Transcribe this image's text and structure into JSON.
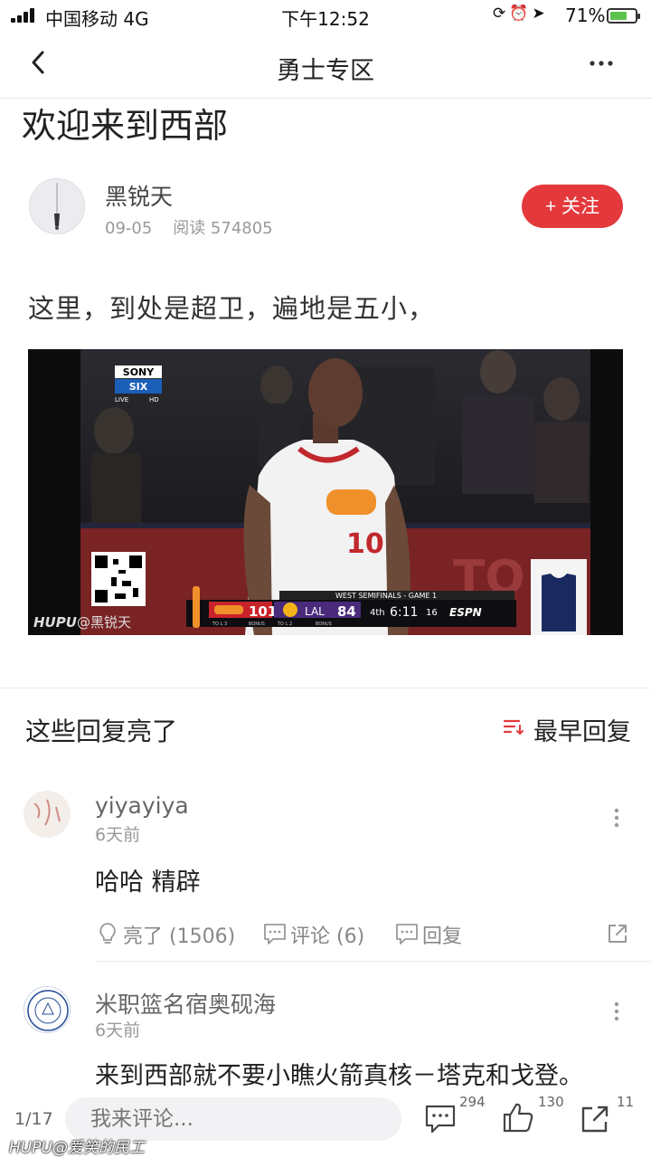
{
  "status_bar": {
    "carrier": "中国移动  4G",
    "time": "下午12:52",
    "battery_pct": "71%",
    "battery_level": 0.71,
    "icons": [
      "rotation-lock-icon",
      "alarm-icon",
      "location-icon"
    ]
  },
  "nav": {
    "title": "勇士专区"
  },
  "article": {
    "title": "欢迎来到西部",
    "author": "黑锐天",
    "date": "09-05",
    "reads": "阅读 574805",
    "follow_label": "+ 关注",
    "body": "这里，到处是超卫，遍地是五小，",
    "image": {
      "network": "SONY",
      "channel": "SIX",
      "channel_sub": "LIVE",
      "channel_hd": "HD",
      "hupu_watermark": "HUPU",
      "hupu_user": "@黑锐天",
      "jersey_number": "10",
      "scorebug": {
        "header": "WEST SEMIFINALS - GAME 1",
        "home_score": "101",
        "away_team": "LAL",
        "away_score": "84",
        "quarter": "4th",
        "clock": "6:11",
        "shot_clock": "16",
        "network": "ESPN",
        "bonus1": "BONUS",
        "bonus2": "BONUS",
        "tol1": "TO L 3",
        "tol2": "TO L 2"
      }
    }
  },
  "replies": {
    "header": "这些回复亮了",
    "sort_label": "最早回复",
    "comments": [
      {
        "name": "yiyayiya",
        "time": "6天前",
        "text": "哈哈 精辟",
        "like": "亮了 (1506)",
        "comment": "评论 (6)",
        "reply": "回复"
      },
      {
        "name": "米职篮名宿奥砚海",
        "time": "6天前",
        "text": "来到西部就不要小瞧火箭真核－塔克和戈登。"
      }
    ]
  },
  "bottom_bar": {
    "page": "1/17",
    "input_placeholder": "我来评论...",
    "comment_count": "294",
    "like_count": "130",
    "share_count": "11",
    "watermark_brand": "HUPU",
    "watermark_user": "@爱笑的民工"
  },
  "colors": {
    "accent": "#e4393c",
    "text": "#222222",
    "muted": "#999999"
  }
}
